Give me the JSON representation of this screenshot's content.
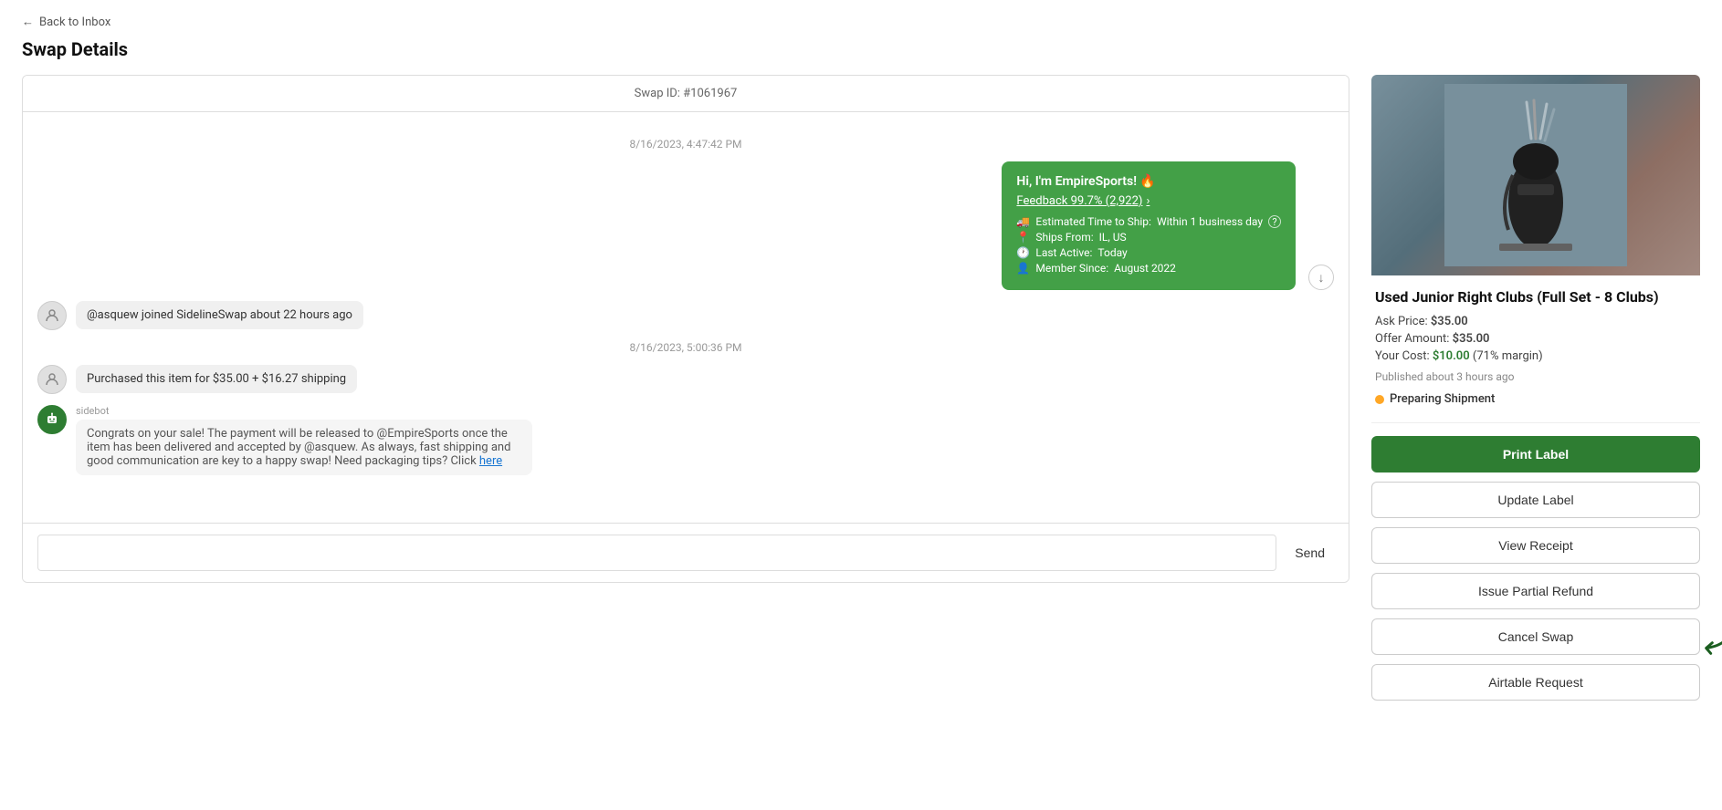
{
  "nav": {
    "back_label": "Back to Inbox"
  },
  "page": {
    "title": "Swap Details"
  },
  "swap": {
    "id_label": "Swap ID: #1061967"
  },
  "chat": {
    "timestamp1": "8/16/2023, 4:47:42 PM",
    "timestamp2": "8/16/2023, 5:00:36 PM",
    "bot_message": {
      "header": "Hi, I'm EmpireSports! 🔥",
      "feedback_text": "Feedback 99.7% (2,922)",
      "feedback_arrow": "›",
      "ship_time_label": "Estimated Time to Ship:",
      "ship_time_value": "Within 1 business day",
      "ships_from_label": "Ships From:",
      "ships_from_value": "IL, US",
      "last_active_label": "Last Active:",
      "last_active_value": "Today",
      "member_since_label": "Member Since:",
      "member_since_value": "August 2022"
    },
    "system_event": "@asquew joined SidelineSwap about 22 hours ago",
    "purchase_message": "Purchased this item for $35.00 + $16.27 shipping",
    "sidebot_label": "sidebot",
    "sidebot_message": "Congrats on your sale! The payment will be released to @EmpireSports once the item has been delivered and accepted by @asquew. As always, fast shipping and good communication are key to a happy swap! Need packaging tips? Click",
    "sidebot_link_text": "here",
    "input_placeholder": "",
    "send_button": "Send"
  },
  "product": {
    "title": "Used Junior Right Clubs (Full Set - 8 Clubs)",
    "ask_price_label": "Ask Price:",
    "ask_price_value": "$35.00",
    "offer_amount_label": "Offer Amount:",
    "offer_amount_value": "$35.00",
    "your_cost_label": "Your Cost:",
    "your_cost_value": "$10.00",
    "margin_label": "(71% margin)",
    "published_label": "Published about 3 hours ago",
    "status_label": "Preparing Shipment"
  },
  "buttons": {
    "print_label": "Print Label",
    "update_label": "Update Label",
    "view_receipt": "View Receipt",
    "issue_refund": "Issue Partial Refund",
    "cancel_swap": "Cancel Swap",
    "airtable": "Airtable Request"
  },
  "icons": {
    "arrow_left": "←",
    "truck": "🚚",
    "pin": "📍",
    "clock": "🕐",
    "person": "👤",
    "question": "?",
    "scroll_down": "↓",
    "chevron_right": "›"
  }
}
